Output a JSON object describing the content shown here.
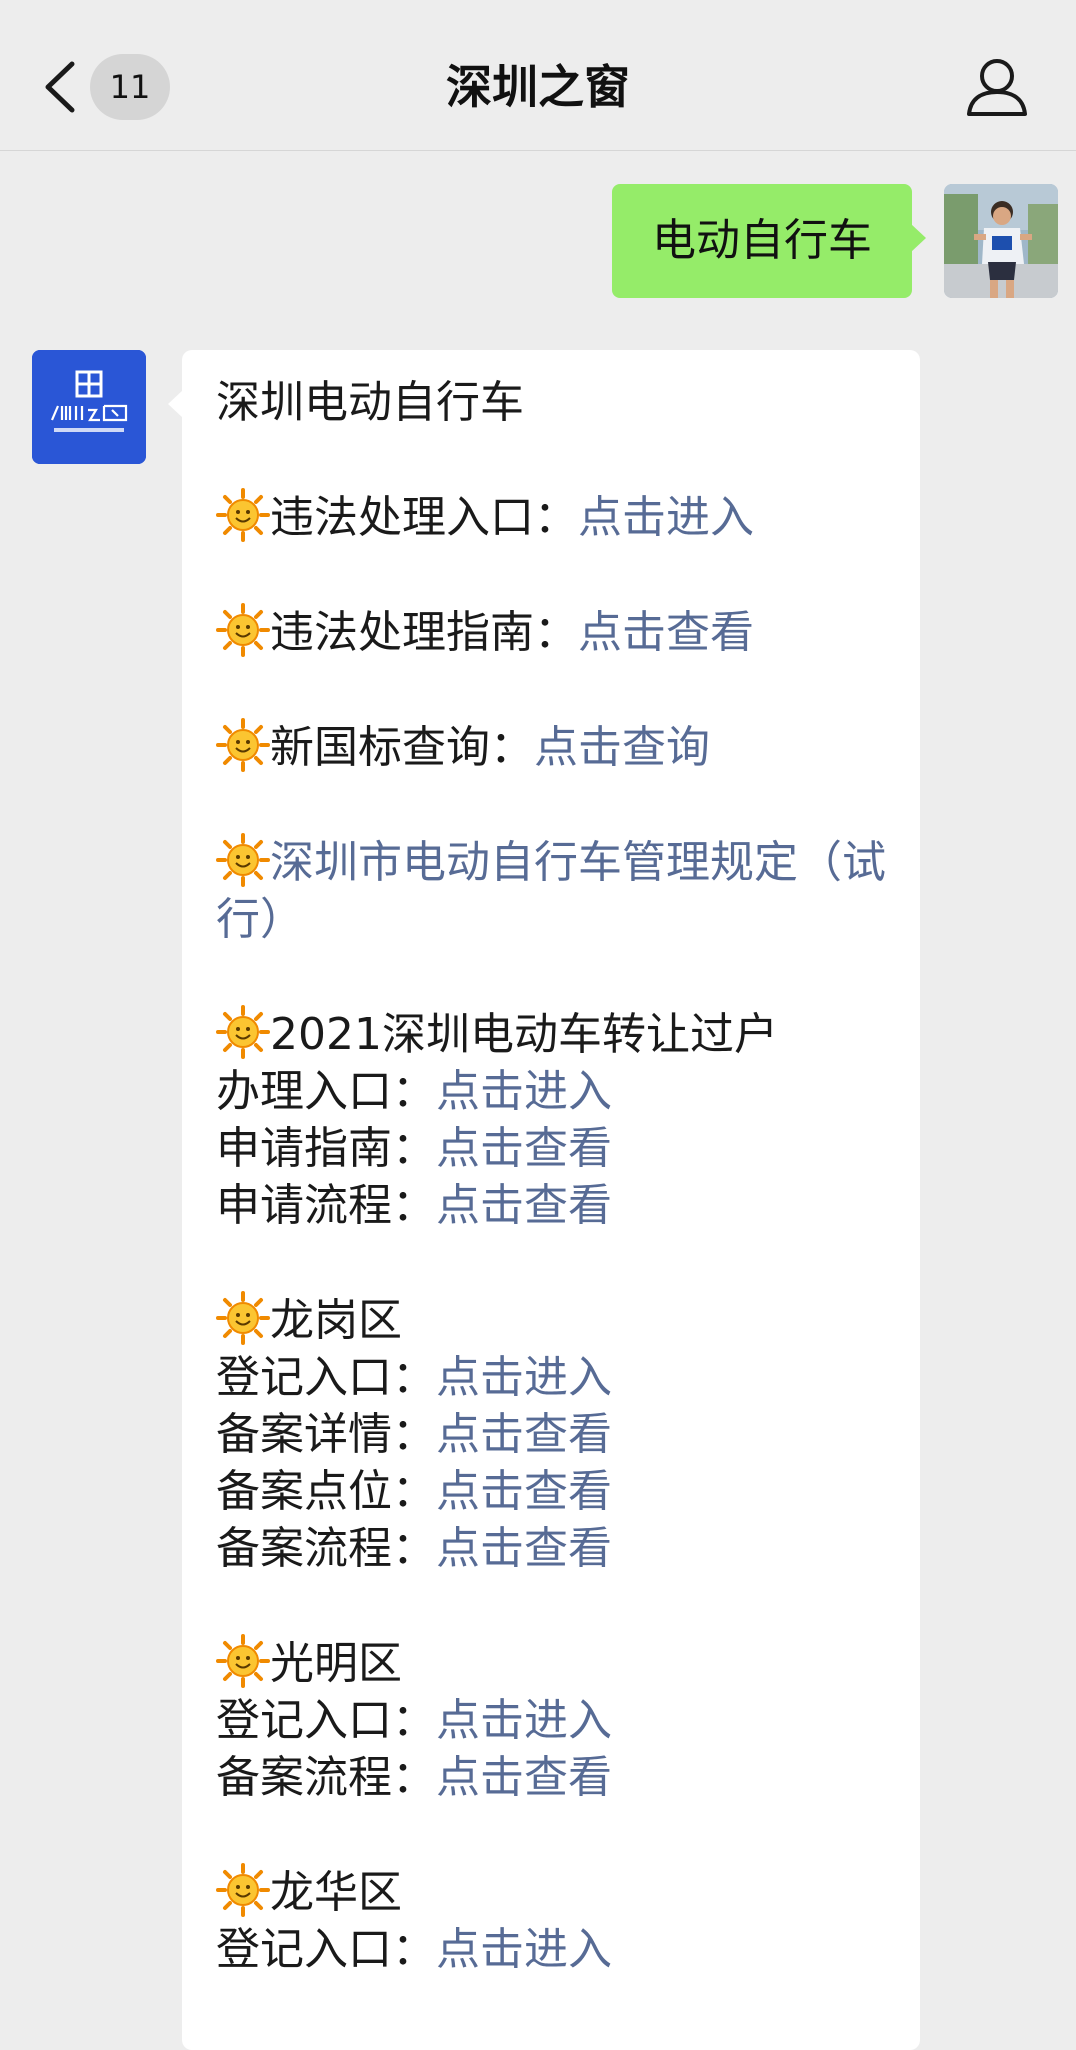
{
  "header": {
    "title": "深圳之窗",
    "unread_count": "11",
    "back_icon": "chevron-left-icon",
    "profile_icon": "person-icon"
  },
  "my_message": {
    "text": "电动自行车"
  },
  "reply": {
    "heading": "深圳电动自行车",
    "sections": [
      {
        "label": "违法处理入口：",
        "link": "点击进入"
      },
      {
        "label": "违法处理指南：",
        "link": "点击查看"
      },
      {
        "label": "新国标查询：",
        "link": "点击查询"
      },
      {
        "link_only": "深圳市电动自行车管理规定（试行）"
      },
      {
        "title": "2021深圳电动车转让过户",
        "rows": [
          {
            "label": "办理入口：",
            "link": "点击进入"
          },
          {
            "label": "申请指南：",
            "link": "点击查看"
          },
          {
            "label": "申请流程：",
            "link": "点击查看"
          }
        ]
      },
      {
        "title": "龙岗区",
        "rows": [
          {
            "label": "登记入口：",
            "link": "点击进入"
          },
          {
            "label": "备案详情：",
            "link": "点击查看"
          },
          {
            "label": "备案点位：",
            "link": "点击查看"
          },
          {
            "label": "备案流程：",
            "link": "点击查看"
          }
        ]
      },
      {
        "title": "光明区",
        "rows": [
          {
            "label": "登记入口：",
            "link": "点击进入"
          },
          {
            "label": "备案流程：",
            "link": "点击查看"
          }
        ]
      },
      {
        "title": "龙华区",
        "rows": [
          {
            "label": "登记入口：",
            "link": "点击进入"
          }
        ]
      }
    ]
  },
  "colors": {
    "background": "#ededed",
    "my_bubble": "#95ec69",
    "link": "#576b95",
    "logo_blue": "#2a56d6"
  },
  "icons": {
    "sun": "smiling-sun-icon"
  }
}
